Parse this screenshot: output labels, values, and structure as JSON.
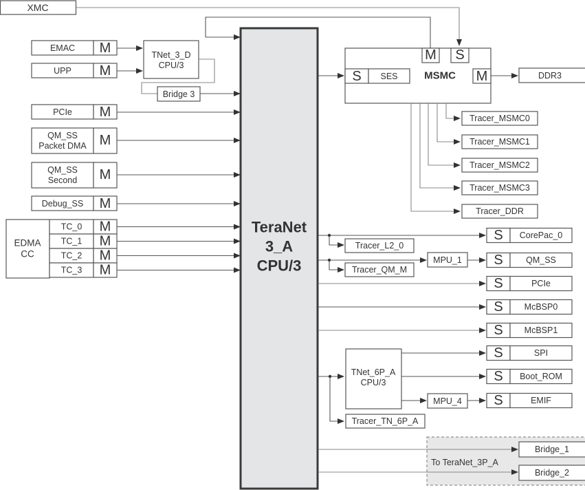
{
  "central": {
    "line1": "TeraNet",
    "line2": "3_A",
    "line3": "CPU/3"
  },
  "xmc": {
    "label": "XMC"
  },
  "masters": {
    "emac": {
      "label": "EMAC",
      "port": "M"
    },
    "upp": {
      "label": "UPP",
      "port": "M"
    },
    "pcie": {
      "label": "PCIe",
      "port": "M"
    },
    "qm_pdma": {
      "line1": "QM_SS",
      "line2": "Packet DMA",
      "port": "M"
    },
    "qm_second": {
      "line1": "QM_SS",
      "line2": "Second",
      "port": "M"
    },
    "debug": {
      "label": "Debug_SS",
      "port": "M"
    },
    "edma": {
      "line1": "EDMA",
      "line2": "CC",
      "tcs": [
        {
          "label": "TC_0",
          "port": "M"
        },
        {
          "label": "TC_1",
          "port": "M"
        },
        {
          "label": "TC_2",
          "port": "M"
        },
        {
          "label": "TC_3",
          "port": "M"
        }
      ]
    }
  },
  "tnet3d": {
    "line1": "TNet_3_D",
    "line2": "CPU/3"
  },
  "bridge3": {
    "label": "Bridge 3"
  },
  "msmc": {
    "title": "MSMC",
    "slave_port": "S",
    "ses_label": "SES",
    "top_master_port": "M",
    "top_slave_port": "S",
    "right_master_port": "M"
  },
  "ddr3": {
    "label": "DDR3"
  },
  "msmc_tracers": [
    "Tracer_MSMC0",
    "Tracer_MSMC1",
    "Tracer_MSMC2",
    "Tracer_MSMC3",
    "Tracer_DDR"
  ],
  "tracer_l2": {
    "label": "Tracer_L2_0"
  },
  "tracer_qm": {
    "label": "Tracer_QM_M"
  },
  "mpu1": {
    "label": "MPU_1"
  },
  "mpu4": {
    "label": "MPU_4"
  },
  "slaves": [
    {
      "port": "S",
      "label": "CorePac_0"
    },
    {
      "port": "S",
      "label": "QM_SS"
    },
    {
      "port": "S",
      "label": "PCIe"
    },
    {
      "port": "S",
      "label": "McBSP0"
    },
    {
      "port": "S",
      "label": "McBSP1"
    },
    {
      "port": "S",
      "label": "SPI"
    },
    {
      "port": "S",
      "label": "Boot_ROM"
    },
    {
      "port": "S",
      "label": "EMIF"
    }
  ],
  "tnet6p": {
    "line1": "TNet_6P_A",
    "line2": "CPU/3"
  },
  "tracer_tn6p": {
    "label": "Tracer_TN_6P_A"
  },
  "bridges_group": {
    "label": "To TeraNet_3P_A",
    "bridges": [
      "Bridge_1",
      "Bridge_2"
    ]
  },
  "colors": {
    "central_fill": "#e4e5e7",
    "group_fill": "#e8e8e8",
    "line": "#555555"
  }
}
